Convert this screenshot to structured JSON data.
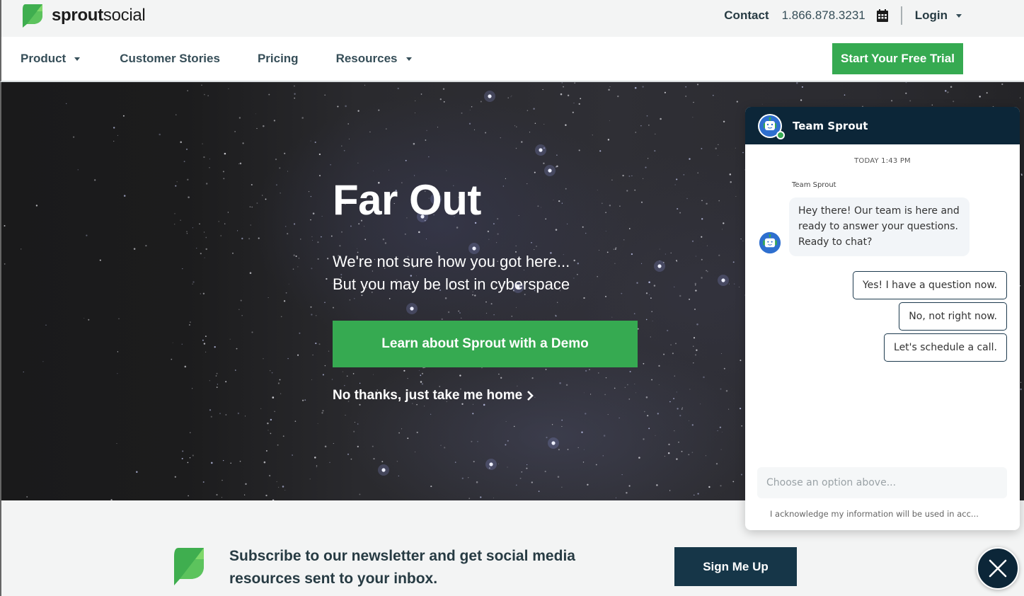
{
  "brand": {
    "name_bold": "sprout",
    "name_light": "social",
    "green": "#36aa51",
    "navy": "#0c2638"
  },
  "topbar": {
    "contact_label": "Contact",
    "phone": "1.866.878.3231",
    "calendar_icon": "calendar-icon",
    "login_label": "Login"
  },
  "nav": {
    "items": [
      {
        "label": "Product",
        "has_dropdown": true
      },
      {
        "label": "Customer Stories",
        "has_dropdown": false
      },
      {
        "label": "Pricing",
        "has_dropdown": false
      },
      {
        "label": "Resources",
        "has_dropdown": true
      }
    ],
    "cta_label": "Start Your Free Trial"
  },
  "hero": {
    "title": "Far Out",
    "subtitle_line1": "We're not sure how you got here...",
    "subtitle_line2": "But you may be lost in cyberspace",
    "demo_button": "Learn about Sprout with a Demo",
    "home_link": "No thanks, just take me home",
    "home_link_icon": "chevron-right-icon"
  },
  "newsletter": {
    "text": "Subscribe to our newsletter and get social media resources sent to your inbox.",
    "button": "Sign Me Up"
  },
  "chat": {
    "title": "Team Sprout",
    "timestamp": "TODAY 1:43 PM",
    "sender": "Team Sprout",
    "message": "Hey there! Our team is here and ready to answer your questions. Ready to chat?",
    "options": [
      "Yes! I have a question now.",
      "No, not right now.",
      "Let's schedule a call."
    ],
    "input_placeholder": "Choose an option above...",
    "acknowledgement": "I acknowledge my information will be used in acc..."
  }
}
